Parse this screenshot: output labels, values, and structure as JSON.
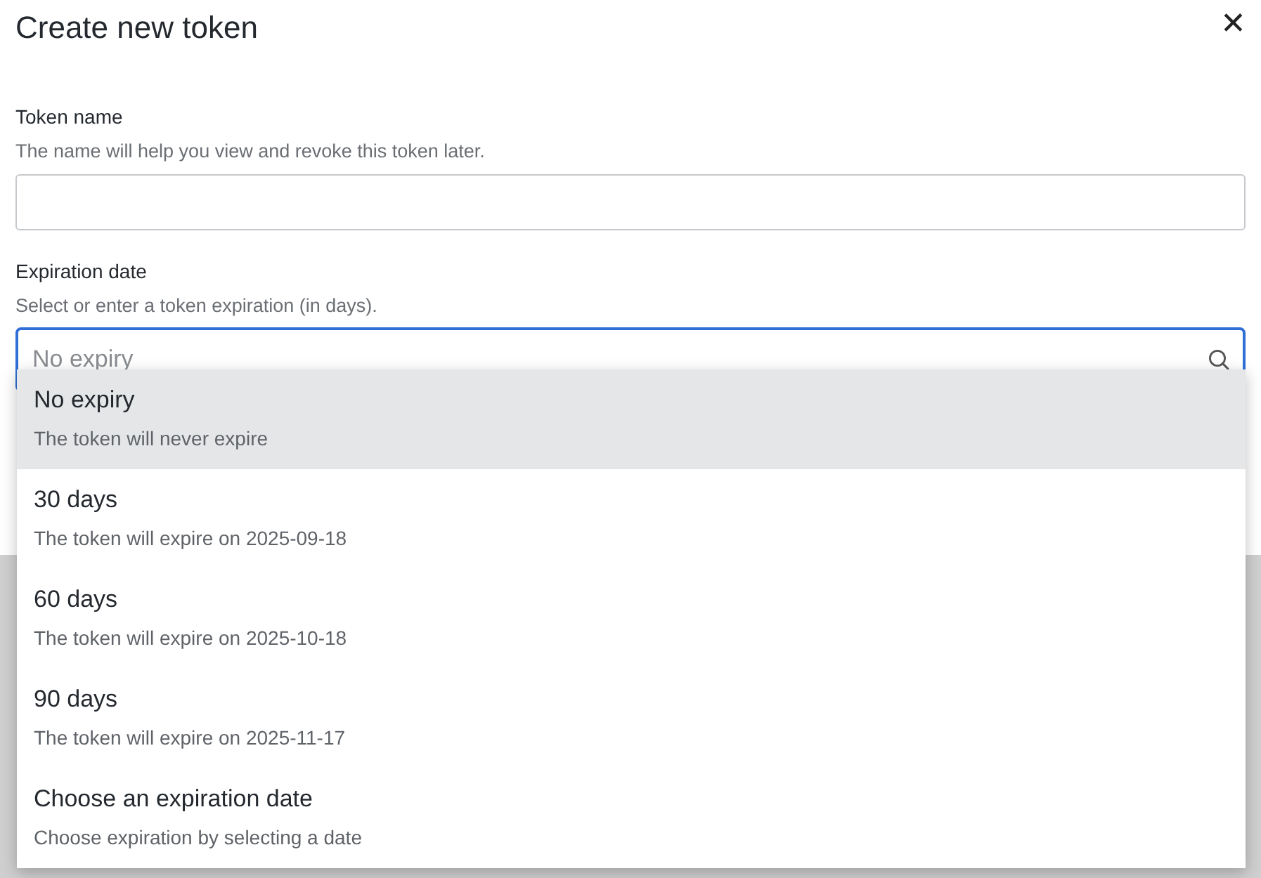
{
  "dialog": {
    "title": "Create new token",
    "close": "✕"
  },
  "fields": [
    {
      "label": "Token name",
      "help": "The name will help you view and revoke this token later.",
      "kind": "text"
    },
    {
      "label": "Expiration date",
      "help": "Select or enter a token expiration (in days).",
      "kind": "combo",
      "placeholder": "No expiry",
      "focused": true
    }
  ],
  "dropdown": {
    "options": [
      {
        "title": "No expiry",
        "description": "The token will never expire",
        "selected": true
      },
      {
        "title": "30 days",
        "description": "The token will expire on 2025-09-18",
        "selected": false
      },
      {
        "title": "60 days",
        "description": "The token will expire on 2025-10-18",
        "selected": false
      },
      {
        "title": "90 days",
        "description": "The token will expire on 2025-11-17",
        "selected": false
      },
      {
        "title": "Choose an expiration date",
        "description": "Choose expiration by selecting a date",
        "selected": false
      }
    ]
  }
}
